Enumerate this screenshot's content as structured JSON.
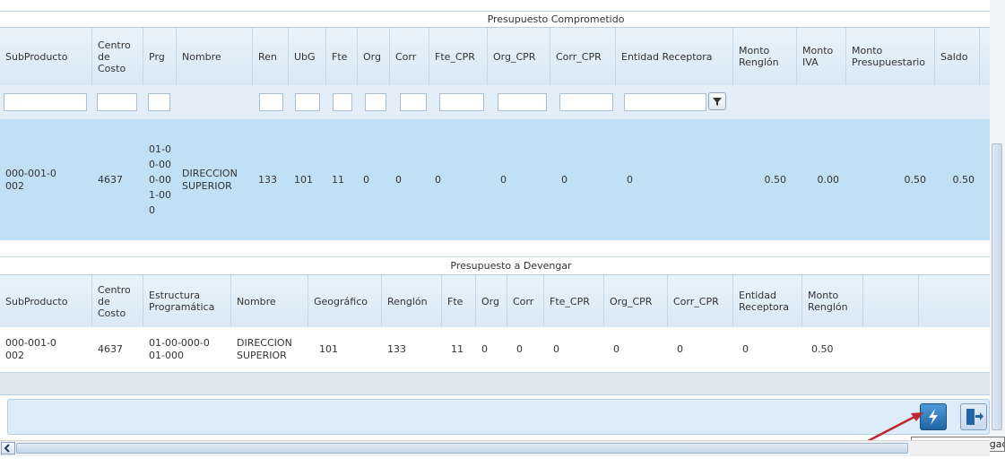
{
  "top_section": {
    "caption": "Presupuesto Comprometido",
    "columns": [
      "SubProducto",
      "Centro de Costo",
      "Prg",
      "Nombre",
      "Ren",
      "UbG",
      "Fte",
      "Org",
      "Corr",
      "Fte_CPR",
      "Org_CPR",
      "Corr_CPR",
      "Entidad Receptora",
      "Monto Renglón",
      "Monto IVA",
      "Monto Presupuestario",
      "Saldo"
    ],
    "row": {
      "subproducto": "000-001-0002",
      "centro": "4637",
      "prg": "01-00-000-001-000",
      "nombre": "DIRECCION SUPERIOR",
      "ren": "133",
      "ubg": "101",
      "fte": "11",
      "org": "0",
      "corr": "0",
      "fte_cpr": "0",
      "org_cpr": "0",
      "corr_cpr": "0",
      "entidad": "0",
      "monto_renglon": "0.50",
      "monto_iva": "0.00",
      "monto_presupuestario": "0.50",
      "saldo": "0.50"
    }
  },
  "bottom_section": {
    "caption": "Presupuesto a Devengar",
    "columns": [
      "SubProducto",
      "Centro de Costo",
      "Estructura Programática",
      "Nombre",
      "Geográfico",
      "Renglón",
      "Fte",
      "Org",
      "Corr",
      "Fte_CPR",
      "Org_CPR",
      "Corr_CPR",
      "Entidad Receptora",
      "Monto Renglón"
    ],
    "row": {
      "subproducto": "000-001-0002",
      "centro": "4637",
      "estructura": "01-00-000-001-000",
      "nombre": "DIRECCION SUPERIOR",
      "geografico": "101",
      "renglon": "133",
      "fte": "11",
      "org": "0",
      "corr": "0",
      "fte_cpr": "0",
      "org_cpr": "0",
      "corr_cpr": "0",
      "entidad": "0",
      "monto_renglon": "0.50"
    }
  },
  "toolbar": {
    "tooltip": "Generar Devengad"
  },
  "icons": {
    "generate": "lightning-icon",
    "exit": "exit-door-icon",
    "filter": "funnel-icon"
  },
  "colors": {
    "accent": "#2f7fc4",
    "selected_row": "#bfe0f5",
    "arrow": "#c0262d"
  }
}
